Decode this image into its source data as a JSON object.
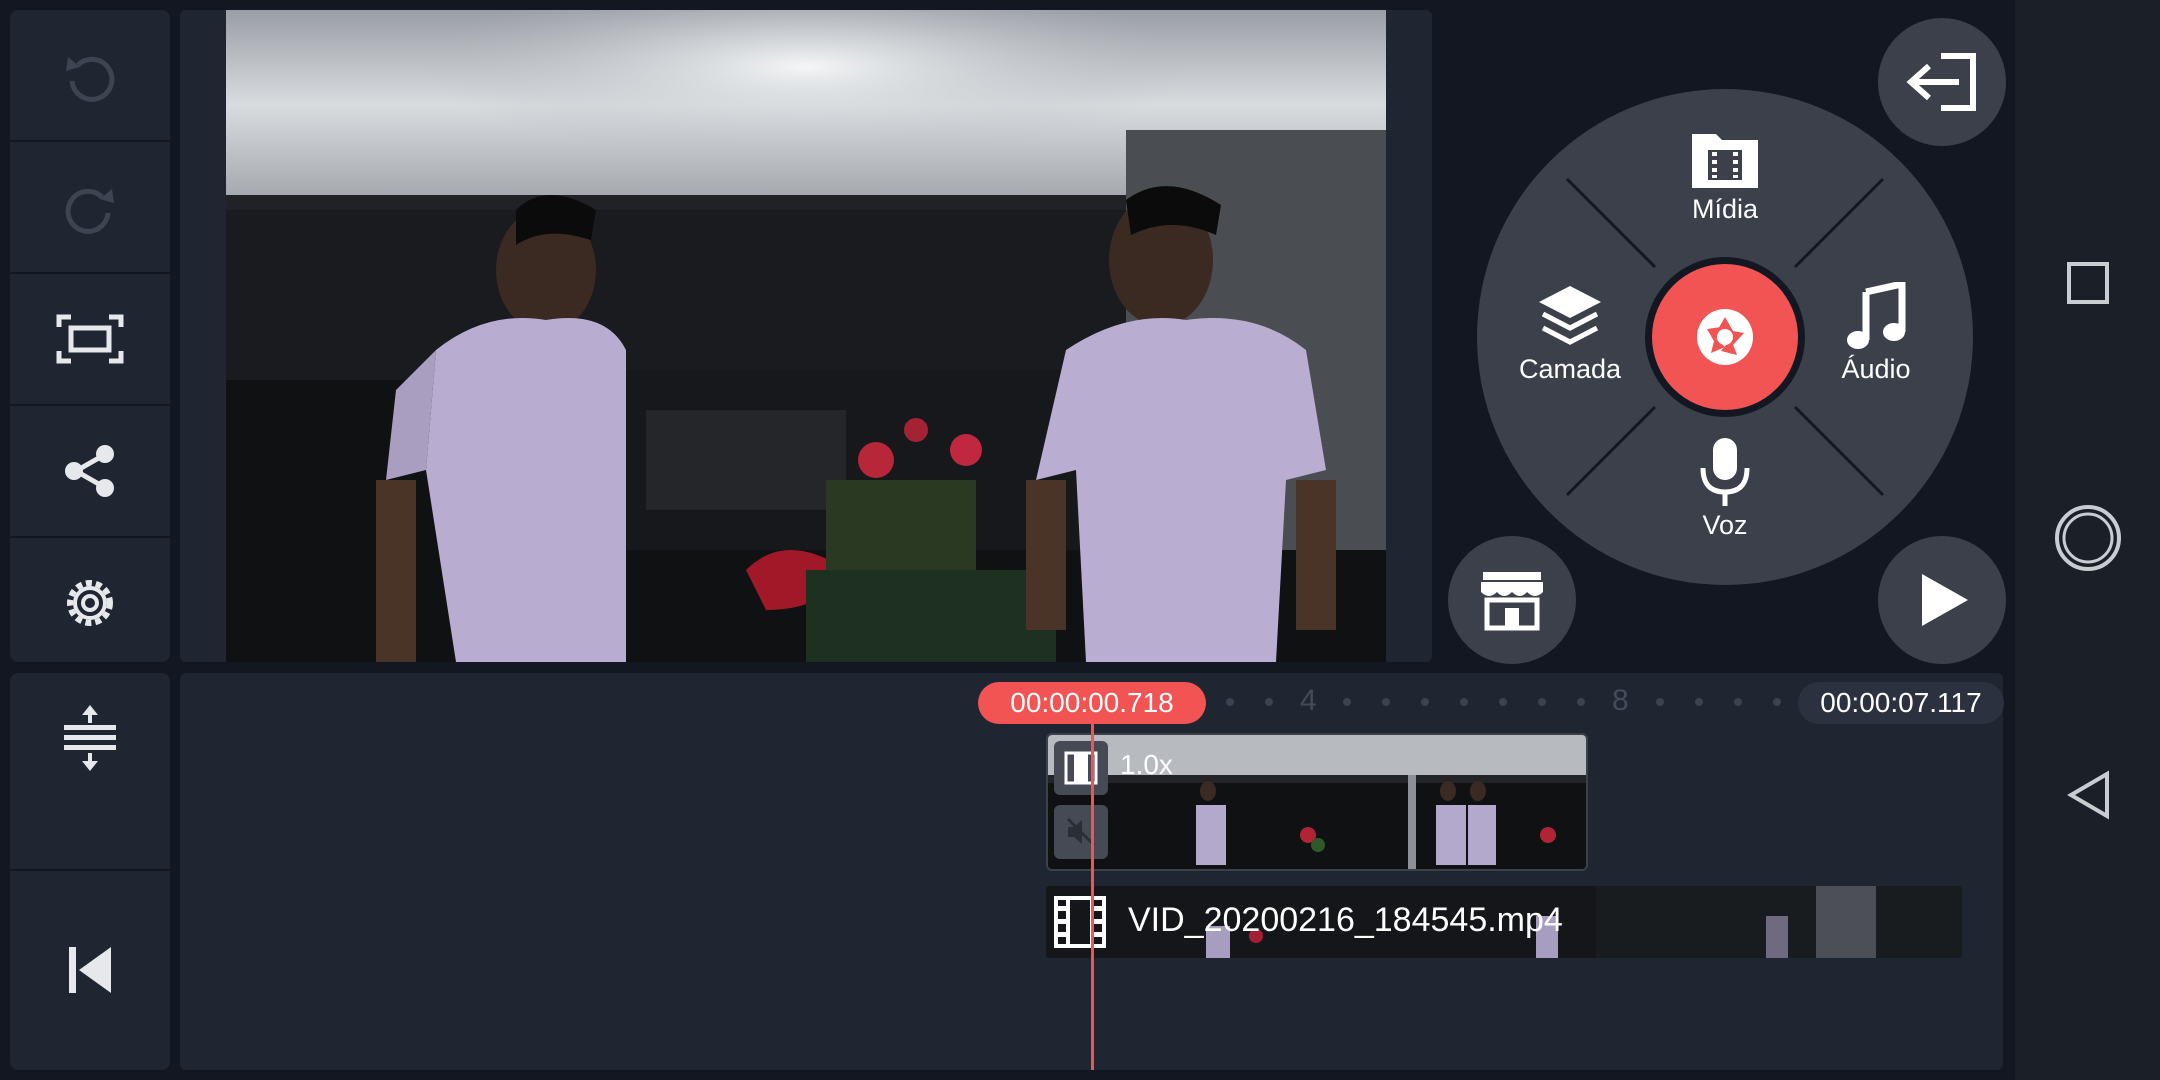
{
  "left_toolbar": {
    "buttons": [
      {
        "icon": "undo-icon"
      },
      {
        "icon": "redo-icon"
      },
      {
        "icon": "crop-frame-icon"
      },
      {
        "icon": "share-icon"
      },
      {
        "icon": "settings-icon"
      }
    ],
    "bottom_buttons": [
      {
        "icon": "expand-timeline-icon"
      },
      {
        "icon": "skip-to-start-icon"
      }
    ]
  },
  "radial_menu": {
    "media_label": "Mídia",
    "layer_label": "Camada",
    "audio_label": "Áudio",
    "voice_label": "Voz",
    "record_icon": "camera-shutter-icon"
  },
  "buttons": {
    "exit_icon": "exit-icon",
    "store_icon": "store-icon",
    "play_icon": "play-icon"
  },
  "timeline": {
    "current_time": "00:00:00.718",
    "total_time": "00:00:07.117",
    "ruler_labels": [
      "4",
      "8"
    ],
    "layer_clip_speed": "1.0x",
    "main_clip_name": "VID_20200216_184545.mp4"
  },
  "colors": {
    "accent": "#f25353",
    "panel": "#1f2531",
    "background": "#121722",
    "menu": "#3b404a"
  },
  "android_nav": {
    "buttons": [
      {
        "icon": "recents-square-icon"
      },
      {
        "icon": "home-circle-icon"
      },
      {
        "icon": "back-triangle-icon"
      }
    ]
  }
}
